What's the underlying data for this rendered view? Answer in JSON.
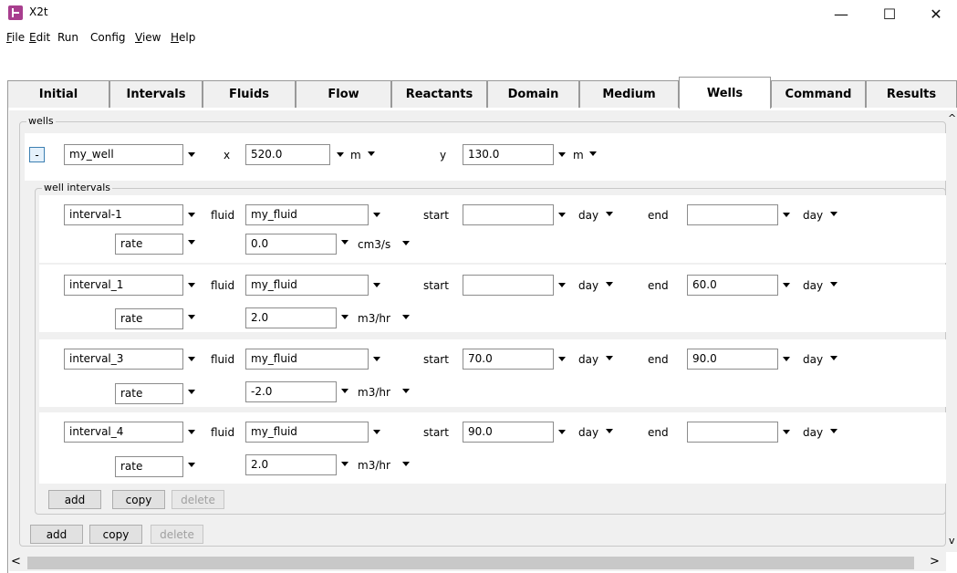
{
  "window": {
    "title": "X2t"
  },
  "window_controls": {
    "minimize": "—",
    "maximize": "☐",
    "close": "✕"
  },
  "menu": [
    {
      "label": "File",
      "ul": true
    },
    {
      "label": "Edit",
      "ul": true
    },
    {
      "label": "Run",
      "ul": false
    },
    {
      "label": "Config",
      "ul": false
    },
    {
      "label": "View",
      "ul": true
    },
    {
      "label": "Help",
      "ul": true
    }
  ],
  "tabs": [
    "Initial",
    "Intervals",
    "Fluids",
    "Flow",
    "Reactants",
    "Domain",
    "Medium",
    "Wells",
    "Command",
    "Results"
  ],
  "active_tab": "Wells",
  "wells": {
    "group_label": "wells",
    "toggle": "-",
    "name": "my_well",
    "x_label": "x",
    "x_value": "520.0",
    "x_unit": "m",
    "y_label": "y",
    "y_value": "130.0",
    "y_unit": "m",
    "intervals_label": "well intervals",
    "intervals": [
      {
        "name": "interval-1",
        "fluid_label": "fluid",
        "fluid": "my_fluid",
        "start_label": "start",
        "start": "",
        "start_unit": "day",
        "end_label": "end",
        "end": "",
        "end_unit": "day",
        "mode": "rate",
        "value": "0.0",
        "value_unit": "cm3/s"
      },
      {
        "name": "interval_1",
        "fluid_label": "fluid",
        "fluid": "my_fluid",
        "start_label": "start",
        "start": "",
        "start_unit": "day",
        "end_label": "end",
        "end": "60.0",
        "end_unit": "day",
        "mode": "rate",
        "value": "2.0",
        "value_unit": "m3/hr"
      },
      {
        "name": "interval_3",
        "fluid_label": "fluid",
        "fluid": "my_fluid",
        "start_label": "start",
        "start": "70.0",
        "start_unit": "day",
        "end_label": "end",
        "end": "90.0",
        "end_unit": "day",
        "mode": "rate",
        "value": "-2.0",
        "value_unit": "m3/hr"
      },
      {
        "name": "interval_4",
        "fluid_label": "fluid",
        "fluid": "my_fluid",
        "start_label": "start",
        "start": "90.0",
        "start_unit": "day",
        "end_label": "end",
        "end": "",
        "end_unit": "day",
        "mode": "rate",
        "value": "2.0",
        "value_unit": "m3/hr"
      }
    ],
    "interval_buttons": {
      "add": "add",
      "copy": "copy",
      "delete": "delete"
    },
    "well_buttons": {
      "add": "add",
      "copy": "copy",
      "delete": "delete"
    }
  },
  "scroll": {
    "up": "^",
    "down": "v",
    "left": "<",
    "right": ">"
  }
}
